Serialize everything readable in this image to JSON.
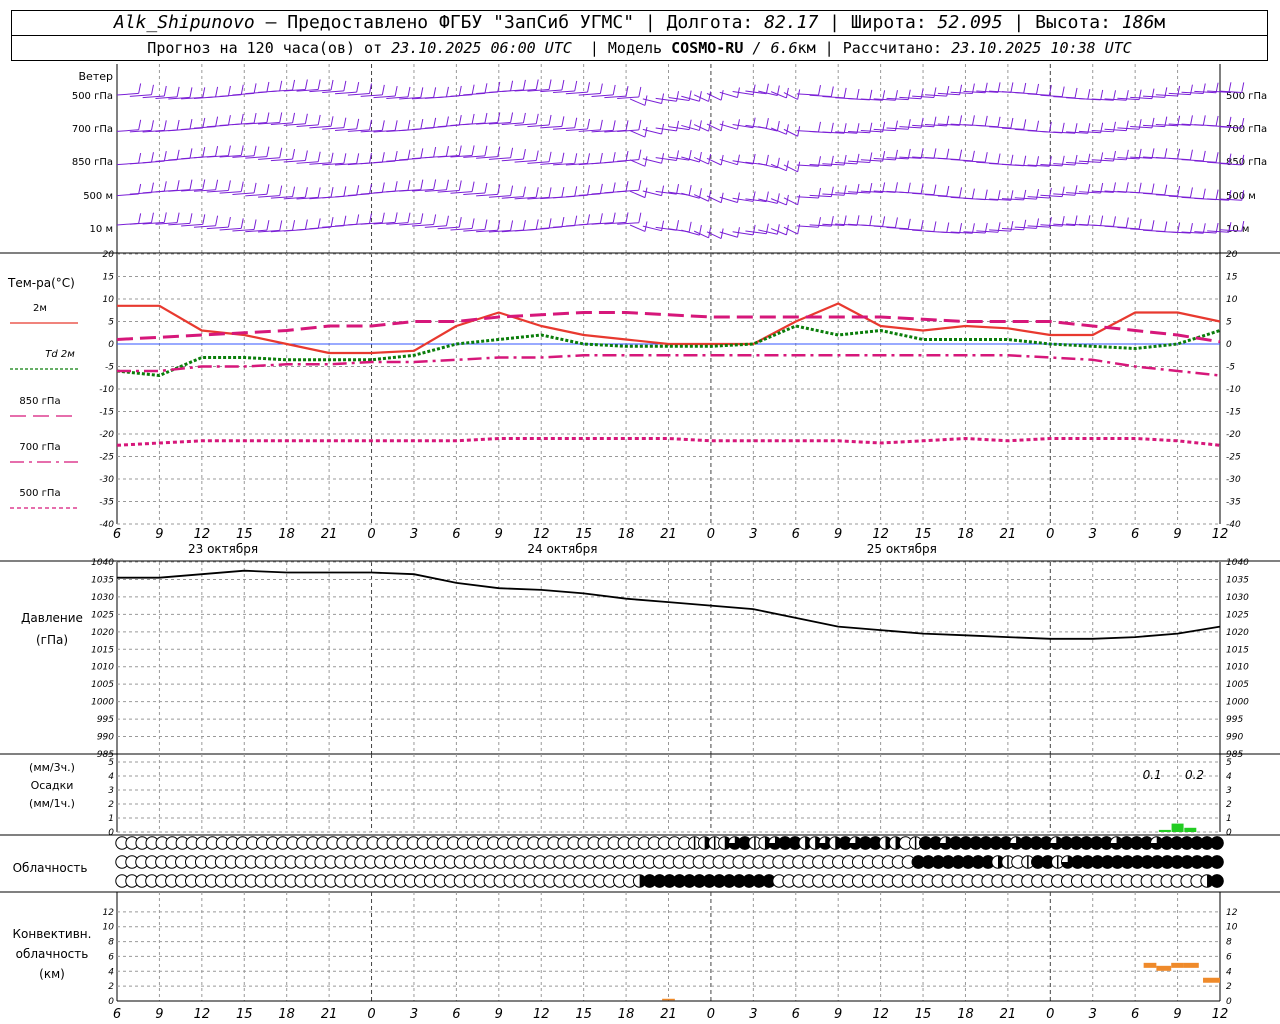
{
  "header": {
    "station": "Alk_Shipunovo",
    "provided_by": "– Предоставлено ФГБУ \"ЗапСиб УГМС\"",
    "lon_label": "Долгота:",
    "lon_value": "82.17",
    "lat_label": "Широта:",
    "lat_value": "52.095",
    "alt_label": "Высота:",
    "alt_value": "186",
    "alt_unit": "м",
    "forecast_label": "Прогноз на 120 часа(ов) от",
    "forecast_start": "23.10.2025 06:00 UTC",
    "model_label": "Модель",
    "model_name": "COSMO-RU",
    "model_res": "/ 6.6",
    "model_res_unit": "км",
    "calc_label": "Рассчитано:",
    "calc_time": "23.10.2025 10:38 UTC"
  },
  "chart_data": {
    "x_ticks": [
      "6",
      "9",
      "12",
      "15",
      "18",
      "21",
      "0",
      "3",
      "6",
      "9",
      "12",
      "15",
      "18",
      "21",
      "0",
      "3",
      "6",
      "9",
      "12",
      "15",
      "18",
      "21",
      "0",
      "3",
      "6",
      "9",
      "12"
    ],
    "day_labels": [
      {
        "text": "23 октября",
        "at_tick": 2.5
      },
      {
        "text": "24 октября",
        "at_tick": 10.5
      },
      {
        "text": "25 октября",
        "at_tick": 18.5
      }
    ],
    "wind": {
      "title": "Ветер",
      "levels": [
        "500 гПа",
        "700 гПа",
        "850 гПа",
        "500 м",
        "10  м"
      ]
    },
    "temperature": {
      "title": "Тем-ра(°С)",
      "ylim": [
        -40,
        20
      ],
      "y_ticks": [
        20,
        15,
        10,
        5,
        0,
        -5,
        -10,
        -15,
        -20,
        -25,
        -30,
        -35,
        -40
      ],
      "legend": [
        {
          "label": "2м",
          "color": "#e8392f",
          "dash": "solid"
        },
        {
          "label": "Td  2м",
          "color": "#0a7d0a",
          "dash": "dotted"
        },
        {
          "label": "850 гПа",
          "color": "#d6177a",
          "dash": "long"
        },
        {
          "label": "700 гПа",
          "color": "#d6177a",
          "dash": "dashdot"
        },
        {
          "label": "500 гПа",
          "color": "#d6177a",
          "dash": "short"
        }
      ],
      "series": [
        {
          "name": "2м",
          "x": [
            0,
            1,
            2,
            3,
            4,
            5,
            6,
            7,
            8,
            9,
            10,
            11,
            12,
            13,
            14,
            15,
            16,
            17,
            18,
            19,
            20,
            21,
            22,
            23,
            24,
            25,
            26
          ],
          "values": [
            8.5,
            8.5,
            3,
            2,
            0,
            -2,
            -2,
            -1.5,
            4,
            7,
            4,
            2,
            1,
            0,
            0,
            0,
            5,
            9,
            4,
            3,
            4,
            3.5,
            2,
            2,
            7,
            7,
            5
          ]
        },
        {
          "name": "Td  2м",
          "x": [
            0,
            1,
            2,
            3,
            4,
            5,
            6,
            7,
            8,
            9,
            10,
            11,
            12,
            13,
            14,
            15,
            16,
            17,
            18,
            19,
            20,
            21,
            22,
            23,
            24,
            25,
            26
          ],
          "values": [
            -6,
            -7,
            -3,
            -3,
            -3.5,
            -3.5,
            -3.5,
            -2.5,
            0,
            1,
            2,
            0,
            -0.5,
            -0.5,
            -0.5,
            0,
            4,
            2,
            3,
            1,
            1,
            1,
            0,
            -0.5,
            -1,
            0,
            3
          ]
        },
        {
          "name": "850 гПа",
          "x": [
            0,
            1,
            2,
            3,
            4,
            5,
            6,
            7,
            8,
            9,
            10,
            11,
            12,
            13,
            14,
            15,
            16,
            17,
            18,
            19,
            20,
            21,
            22,
            23,
            24,
            25,
            26
          ],
          "values": [
            1,
            1.5,
            2,
            2.5,
            3,
            4,
            4,
            5,
            5,
            6,
            6.5,
            7,
            7,
            6.5,
            6,
            6,
            6,
            6,
            6,
            5.5,
            5,
            5,
            5,
            4,
            3,
            2,
            0.5
          ]
        },
        {
          "name": "700 гПа",
          "x": [
            0,
            1,
            2,
            3,
            4,
            5,
            6,
            7,
            8,
            9,
            10,
            11,
            12,
            13,
            14,
            15,
            16,
            17,
            18,
            19,
            20,
            21,
            22,
            23,
            24,
            25,
            26
          ],
          "values": [
            -6,
            -6,
            -5,
            -5,
            -4.5,
            -4.5,
            -4,
            -4,
            -3.5,
            -3,
            -3,
            -2.5,
            -2.5,
            -2.5,
            -2.5,
            -2.5,
            -2.5,
            -2.5,
            -2.5,
            -2.5,
            -2.5,
            -2.5,
            -3,
            -3.5,
            -5,
            -6,
            -7
          ]
        },
        {
          "name": "500 гПа",
          "x": [
            0,
            1,
            2,
            3,
            4,
            5,
            6,
            7,
            8,
            9,
            10,
            11,
            12,
            13,
            14,
            15,
            16,
            17,
            18,
            19,
            20,
            21,
            22,
            23,
            24,
            25,
            26
          ],
          "values": [
            -22.5,
            -22,
            -21.5,
            -21.5,
            -21.5,
            -21.5,
            -21.5,
            -21.5,
            -21.5,
            -21,
            -21,
            -21,
            -21,
            -21,
            -21.5,
            -21.5,
            -21.5,
            -21.5,
            -22,
            -21.5,
            -21,
            -21.5,
            -21,
            -21,
            -21,
            -21.5,
            -22.5
          ]
        }
      ]
    },
    "pressure": {
      "title": "Давление",
      "unit": "(гПа)",
      "ylim": [
        985,
        1040
      ],
      "y_ticks": [
        1040,
        1035,
        1030,
        1025,
        1020,
        1015,
        1010,
        1005,
        1000,
        995,
        990,
        985
      ],
      "x": [
        0,
        1,
        2,
        3,
        4,
        5,
        6,
        7,
        8,
        9,
        10,
        11,
        12,
        13,
        14,
        15,
        16,
        17,
        18,
        19,
        20,
        21,
        22,
        23,
        24,
        25,
        26
      ],
      "values": [
        1035.5,
        1035.5,
        1036.5,
        1037.5,
        1037,
        1037,
        1037,
        1036.5,
        1034,
        1032.5,
        1032,
        1031,
        1029.5,
        1028.5,
        1027.5,
        1026.5,
        1024,
        1021.5,
        1020.5,
        1019.5,
        1019,
        1018.5,
        1018,
        1018,
        1018.5,
        1019.5,
        1021.5
      ]
    },
    "precipitation": {
      "unit3": "(мм/3ч.)",
      "title": "Осадки",
      "unit1": "(мм/1ч.)",
      "ylim": [
        0,
        5
      ],
      "y_ticks": [
        5,
        4,
        3,
        2,
        1,
        0
      ],
      "labels": [
        {
          "text": "0.1",
          "at_tick": 24.4
        },
        {
          "text": "0.2",
          "at_tick": 25.4
        }
      ],
      "bars": [
        {
          "x": 24.7,
          "value": 0.05
        },
        {
          "x": 25.0,
          "value": 0.2
        },
        {
          "x": 25.3,
          "value": 0.1
        }
      ]
    },
    "cloudiness": {
      "title": "Облачность",
      "rows": [
        {
          "name": "upper",
          "cover": [
            0,
            0,
            0,
            0,
            0,
            0,
            0,
            0,
            0,
            0,
            0,
            0,
            0,
            0,
            0,
            0,
            0,
            0,
            0,
            0,
            0,
            0,
            0,
            0,
            0,
            0,
            0,
            0,
            0,
            0,
            0,
            0,
            0,
            0,
            0,
            0,
            0,
            0,
            0,
            0,
            0,
            0,
            0,
            0,
            0,
            0,
            0,
            0,
            0,
            0,
            0,
            0,
            0,
            0,
            0,
            0,
            0,
            1,
            2,
            1,
            2,
            3,
            4,
            1,
            2,
            3,
            4,
            4,
            2,
            2,
            3,
            2,
            4,
            3,
            4,
            4,
            2,
            2,
            0,
            1,
            4,
            4,
            3,
            4,
            4,
            4,
            4,
            4,
            4,
            3,
            4,
            4,
            4,
            3,
            4,
            4,
            4,
            4,
            4,
            3,
            4,
            4,
            4,
            3,
            4,
            4,
            4,
            4,
            4,
            4
          ]
        },
        {
          "name": "middle",
          "cover": [
            0,
            0,
            0,
            0,
            0,
            0,
            0,
            0,
            0,
            0,
            0,
            0,
            0,
            0,
            0,
            0,
            0,
            0,
            0,
            0,
            0,
            0,
            0,
            0,
            0,
            0,
            0,
            0,
            0,
            0,
            0,
            0,
            0,
            0,
            0,
            0,
            0,
            0,
            0,
            0,
            0,
            0,
            0,
            0,
            0,
            0,
            0,
            0,
            0,
            0,
            0,
            0,
            0,
            0,
            0,
            0,
            0,
            0,
            0,
            0,
            0,
            0,
            0,
            0,
            0,
            0,
            0,
            0,
            0,
            0,
            0,
            0,
            0,
            0,
            0,
            0,
            0,
            0,
            0,
            0,
            4,
            4,
            4,
            4,
            4,
            4,
            4,
            4,
            2,
            1,
            0,
            1,
            4,
            4,
            1,
            3,
            4,
            4,
            4,
            4,
            4,
            4,
            4,
            4,
            4,
            4,
            4,
            4,
            4,
            4,
            4
          ]
        },
        {
          "name": "lower",
          "cover": [
            0,
            0,
            0,
            0,
            0,
            0,
            0,
            0,
            0,
            0,
            0,
            0,
            0,
            0,
            0,
            0,
            0,
            0,
            0,
            0,
            0,
            0,
            0,
            0,
            0,
            0,
            0,
            0,
            0,
            0,
            0,
            0,
            0,
            0,
            0,
            0,
            0,
            0,
            0,
            0,
            0,
            0,
            0,
            0,
            0,
            0,
            0,
            0,
            0,
            0,
            0,
            0,
            2,
            4,
            4,
            4,
            4,
            4,
            4,
            4,
            4,
            4,
            4,
            4,
            4,
            4,
            0,
            0,
            0,
            0,
            0,
            0,
            0,
            0,
            0,
            0,
            0,
            0,
            0,
            0,
            0,
            0,
            0,
            0,
            0,
            0,
            0,
            0,
            0,
            0,
            0,
            0,
            0,
            0,
            0,
            0,
            0,
            0,
            0,
            0,
            0,
            0,
            0,
            0,
            0,
            0,
            0,
            0,
            0,
            2,
            4
          ]
        }
      ]
    },
    "convective": {
      "title1": "Конвективн.",
      "title2": "облачность",
      "unit": "(км)",
      "ylim": [
        0,
        14
      ],
      "y_ticks": [
        12,
        10,
        8,
        6,
        4,
        2,
        0
      ],
      "segments": [
        {
          "x0": 12.85,
          "x1": 13.15,
          "value": 0.2
        },
        {
          "x0": 24.2,
          "x1": 24.5,
          "value": 4.8
        },
        {
          "x0": 24.5,
          "x1": 24.85,
          "value": 4.4
        },
        {
          "x0": 24.85,
          "x1": 25.15,
          "value": 4.8
        },
        {
          "x0": 25.15,
          "x1": 25.5,
          "value": 4.8
        },
        {
          "x0": 25.6,
          "x1": 26.0,
          "value": 2.8
        }
      ]
    }
  },
  "colors": {
    "wind_barb": "#7a1fd6",
    "grid": "#999999",
    "t2m": "#e8392f",
    "td": "#0a7d0a",
    "upper_air": "#d6177a",
    "pressure": "#000000",
    "precip": "#22cc22",
    "convective": "#ef8a2a",
    "zero_line": "#3355ff"
  }
}
